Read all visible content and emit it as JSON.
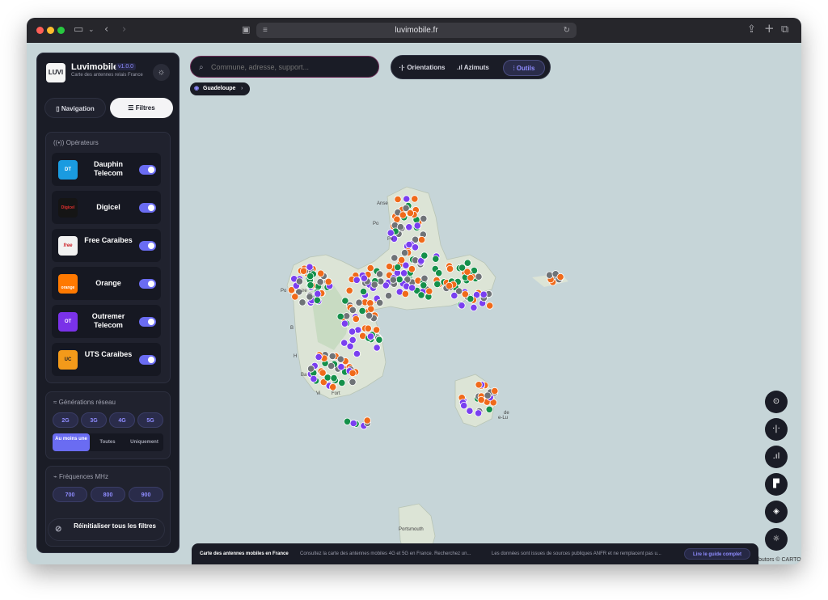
{
  "browser": {
    "url": "luvimobile.fr",
    "traffic_light_colors": [
      "#ff5f57",
      "#febc2e",
      "#28c840"
    ]
  },
  "sidebar": {
    "logo_text": "LUVI",
    "app_name": "Luvimobile",
    "version": "v1.0.0",
    "subtitle": "Carte des antennes relais France",
    "tabs": [
      {
        "label": "Navigation",
        "icon": "map-icon",
        "active": false
      },
      {
        "label": "Filtres",
        "icon": "sliders-icon",
        "active": true
      }
    ],
    "operators_title": "Opérateurs",
    "operators": [
      {
        "name": "Dauphin Telecom",
        "logo": "DT",
        "color": "#1a9be0",
        "enabled": true
      },
      {
        "name": "Digicel",
        "logo": "Digicel",
        "color": "#151515",
        "enabled": true
      },
      {
        "name": "Free Caraibes",
        "logo": "free",
        "color": "#f2f2f2",
        "enabled": true
      },
      {
        "name": "Orange",
        "logo": "orange",
        "color": "#ff7900",
        "enabled": true
      },
      {
        "name": "Outremer Telecom",
        "logo": "OT",
        "color": "#7a32e8",
        "enabled": true
      },
      {
        "name": "UTS Caraibes",
        "logo": "UC",
        "color": "#f39a1a",
        "enabled": true
      }
    ],
    "generations_title": "Générations réseau",
    "generations": [
      "2G",
      "3G",
      "4G",
      "5G"
    ],
    "match_modes": [
      {
        "label": "Au moins une",
        "active": true
      },
      {
        "label": "Toutes",
        "active": false
      },
      {
        "label": "Uniquement",
        "active": false
      }
    ],
    "frequencies_title": "Fréquences MHz",
    "frequencies": [
      "700",
      "800",
      "900"
    ],
    "reset_label": "Réinitialiser tous les filtres"
  },
  "search": {
    "placeholder": "Commune, adresse, support..."
  },
  "toolbar": {
    "items": [
      {
        "label": "Orientations",
        "active": false
      },
      {
        "label": "Azimuts",
        "active": false
      },
      {
        "label": "Outils",
        "active": true
      }
    ]
  },
  "region": {
    "label": "Guadeloupe"
  },
  "map": {
    "places": [
      "Anse",
      "Po",
      "Pe",
      "Po",
      "ire",
      "B",
      "H",
      "Ba",
      "Vi",
      "Fort",
      "de",
      "e-Lu",
      "Portsmouth"
    ],
    "marker_colors": {
      "orange": "#f06a1a",
      "green": "#14904a",
      "purple": "#7a3ff0",
      "gray": "#6f7377"
    }
  },
  "footer": {
    "title": "Carte des antennes mobiles en France",
    "text1": "Consultez la carte des antennes mobiles 4G et 5G en France. Recherchez un...",
    "text2": "Les données sont issues de sources publiques ANFR et ne remplacent pas u...",
    "guide_label": "Lire le guide complet",
    "attribution": "butors © CARTO"
  },
  "colors": {
    "accent": "#6a6cf2",
    "panel": "#1a1c26",
    "sea": "#c6d5d8",
    "land": "#dfe5dc"
  }
}
